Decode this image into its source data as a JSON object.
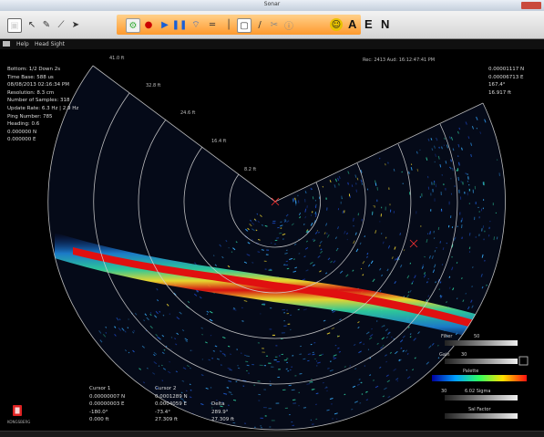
{
  "window": {
    "title": "Sonar"
  },
  "toolbar": {
    "letters": [
      "A",
      "E",
      "N"
    ]
  },
  "menubar": {
    "items": [
      "Help",
      "Head Sight"
    ]
  },
  "status_top": "Rec: 2413 Aud: 16:12:47:41 PM",
  "info": {
    "lines": [
      "Bottom: 1/2 Down 2s",
      "Time Base: 588 us",
      "08/08/2013 02:16:34 PM",
      "Resolution: 8.3 cm",
      "Number of Samples: 318",
      "Update Rate: 6.3 Hz | 2.9 Hz",
      "Ping Number: 785",
      "Heading: 0.6",
      "0.000000 N",
      "0.000000 E"
    ]
  },
  "top_right": {
    "lines": [
      "0.00001117 N",
      "0.00006713 E",
      "167.4°",
      "16.917 ft"
    ]
  },
  "range_labels": [
    "41.0 ft",
    "32.8 ft",
    "24.6 ft",
    "16.4 ft",
    "8.2 ft"
  ],
  "cursors": {
    "c1": {
      "label": "Cursor 1",
      "lines": [
        "0.00000007 N",
        "0.00000003 E",
        "-180.0°",
        "0.000 ft"
      ]
    },
    "c2": {
      "label": "Cursor 2",
      "lines": [
        "0.0001289 N",
        "0.0004059 E",
        "-73.4°",
        "27.309 ft"
      ]
    },
    "delta": {
      "label": "Delta",
      "lines": [
        "289.9°",
        "27.309 ft"
      ]
    }
  },
  "controls": {
    "filter_label": "Filter",
    "filter_value": "50",
    "gain_label": "Gain",
    "gain_value": "30",
    "palette_label": "Palette",
    "range_value": "30",
    "range_label": "6.02 Sigma",
    "sal_factor_label": "Sal Factor"
  },
  "logo_text": "KONGSBERG",
  "colors": {
    "accent": "#ff9a2e",
    "echo_red": "#e01010",
    "grid": "#d0d0d0"
  }
}
